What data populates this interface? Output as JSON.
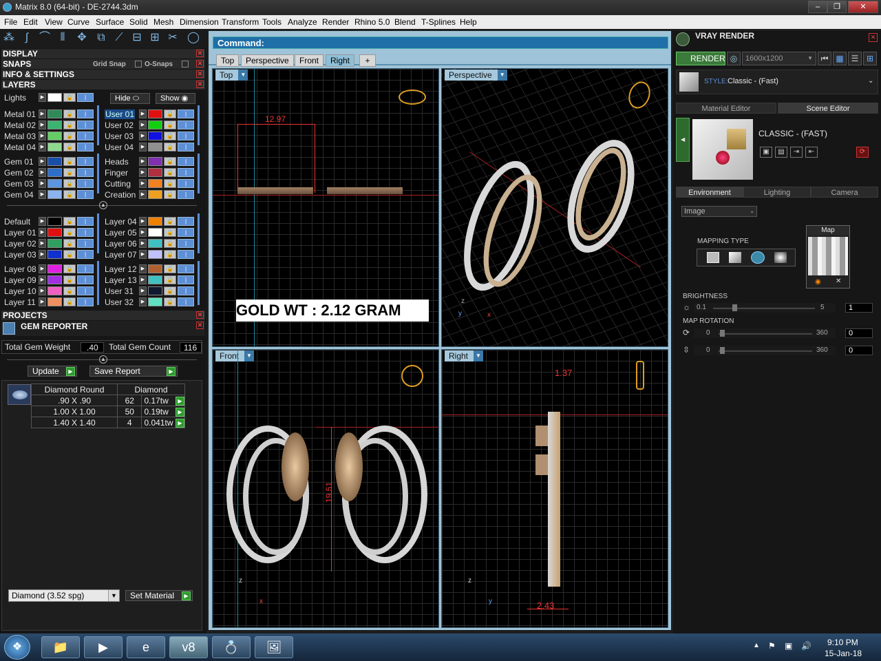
{
  "window": {
    "title": "Matrix 8.0 (64-bit) - DE-2744.3dm"
  },
  "menu": [
    "File",
    "Edit",
    "View",
    "Curve",
    "Surface",
    "Solid",
    "Mesh",
    "Dimension",
    "Transform",
    "Tools",
    "Analyze",
    "Render",
    "Rhino 5.0",
    "Blend",
    "T-Splines",
    "Help"
  ],
  "left": {
    "display": "DISPLAY",
    "snaps": "SNAPS",
    "grid_snap": "Grid Snap",
    "o_snaps": "O-Snaps",
    "info": "INFO & SETTINGS",
    "layers": "LAYERS",
    "lights": "Lights",
    "hide": "Hide",
    "show": "Show",
    "layer_col1": [
      {
        "name": "Metal 01",
        "color": "#2e8b57"
      },
      {
        "name": "Metal 02",
        "color": "#3cb371"
      },
      {
        "name": "Metal 03",
        "color": "#66cc66"
      },
      {
        "name": "Metal 04",
        "color": "#8fd98f"
      },
      {
        "name": "Gem 01",
        "color": "#1a4fa8"
      },
      {
        "name": "Gem 02",
        "color": "#2d6fc8"
      },
      {
        "name": "Gem 03",
        "color": "#5c95e0"
      },
      {
        "name": "Gem 04",
        "color": "#8cb4ee"
      },
      {
        "name": "Default",
        "color": "#000000"
      },
      {
        "name": "Layer 01",
        "color": "#e01010"
      },
      {
        "name": "Layer 02",
        "color": "#30a060"
      },
      {
        "name": "Layer 03",
        "color": "#1030d0"
      },
      {
        "name": "Layer 08",
        "color": "#e020e0"
      },
      {
        "name": "Layer 09",
        "color": "#a030e0"
      },
      {
        "name": "Layer 10",
        "color": "#f060c0"
      },
      {
        "name": "Layer 11",
        "color": "#f09060"
      }
    ],
    "layer_col2": [
      {
        "name": "User 01",
        "color": "#e01010"
      },
      {
        "name": "User 02",
        "color": "#10d010"
      },
      {
        "name": "User 03",
        "color": "#1010e0"
      },
      {
        "name": "User 04",
        "color": "#909090"
      },
      {
        "name": "Heads",
        "color": "#8030b0"
      },
      {
        "name": "Finger",
        "color": "#b03040"
      },
      {
        "name": "Cutting",
        "color": "#f08020"
      },
      {
        "name": "Creation",
        "color": "#f0a020"
      },
      {
        "name": "Layer 04",
        "color": "#f08000"
      },
      {
        "name": "Layer 05",
        "color": "#ffffff"
      },
      {
        "name": "Layer 06",
        "color": "#40c0c0"
      },
      {
        "name": "Layer 07",
        "color": "#c0c0ff"
      },
      {
        "name": "Layer 12",
        "color": "#b06030"
      },
      {
        "name": "Layer 13",
        "color": "#40c0c0"
      },
      {
        "name": "User 31",
        "color": "#101830"
      },
      {
        "name": "User 32",
        "color": "#60e0c0"
      }
    ],
    "projects": "PROJECTS",
    "gem_reporter": "GEM REPORTER",
    "total_weight_label": "Total Gem Weight",
    "total_weight": ".40",
    "total_count_label": "Total Gem Count",
    "total_count": "116",
    "update": "Update",
    "save_report": "Save Report",
    "table_headers": [
      "Diamond Round",
      "Diamond"
    ],
    "rows": [
      {
        "size": ".90 X .90",
        "count": "62",
        "tw": "0.17tw"
      },
      {
        "size": "1.00 X 1.00",
        "count": "50",
        "tw": "0.19tw"
      },
      {
        "size": "1.40 X 1.40",
        "count": "4",
        "tw": "0.041tw"
      }
    ],
    "material_select": "Diamond    (3.52 spg)",
    "set_material": "Set Material"
  },
  "command": {
    "label": "Command:"
  },
  "view_tabs": [
    "Top",
    "Perspective",
    "Front",
    "Right"
  ],
  "viewports": {
    "top": {
      "label": "Top",
      "dim": "12.97",
      "overlay": "GOLD WT : 2.12 GRAM"
    },
    "perspective": {
      "label": "Perspective"
    },
    "front": {
      "label": "Front",
      "dim": "19.51"
    },
    "right": {
      "label": "Right",
      "dim_top": "1.37",
      "dim_bottom": "2.43"
    }
  },
  "vray": {
    "title": "VRAY RENDER",
    "render": "RENDER",
    "resolution": "1600x1200",
    "style_label": "STYLE:",
    "style": "Classic - (Fast)",
    "tabs": [
      "Material Editor",
      "Scene Editor"
    ],
    "scene_name": "CLASSIC - (FAST)",
    "env_tabs": [
      "Environment",
      "Lighting",
      "Camera"
    ],
    "image_select": "Image",
    "mapping_type": "MAPPING TYPE",
    "map": "Map",
    "brightness": "BRIGHTNESS",
    "bright_min": "0.1",
    "bright_max": "5",
    "bright_val": "1",
    "map_rotation": "MAP ROTATION",
    "rot_min": "0",
    "rot_max": "360",
    "rot_val": "0"
  },
  "taskbar": {
    "time": "9:10 PM",
    "date": "15-Jan-18"
  }
}
